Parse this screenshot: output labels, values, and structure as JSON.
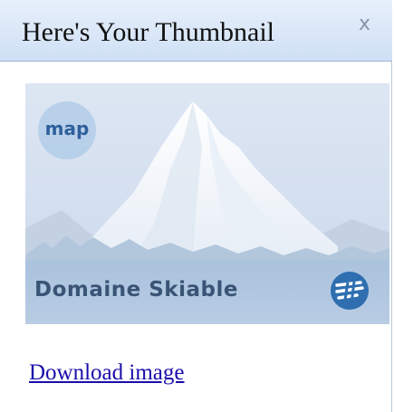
{
  "dialog": {
    "title": "Here's Your Thumbnail",
    "close_label": "x"
  },
  "thumbnail": {
    "badge_text": "map",
    "brand_text": "Domaine Skiable",
    "logo_icon": "ski-lift-logo-icon"
  },
  "actions": {
    "download_label": "Download image"
  }
}
